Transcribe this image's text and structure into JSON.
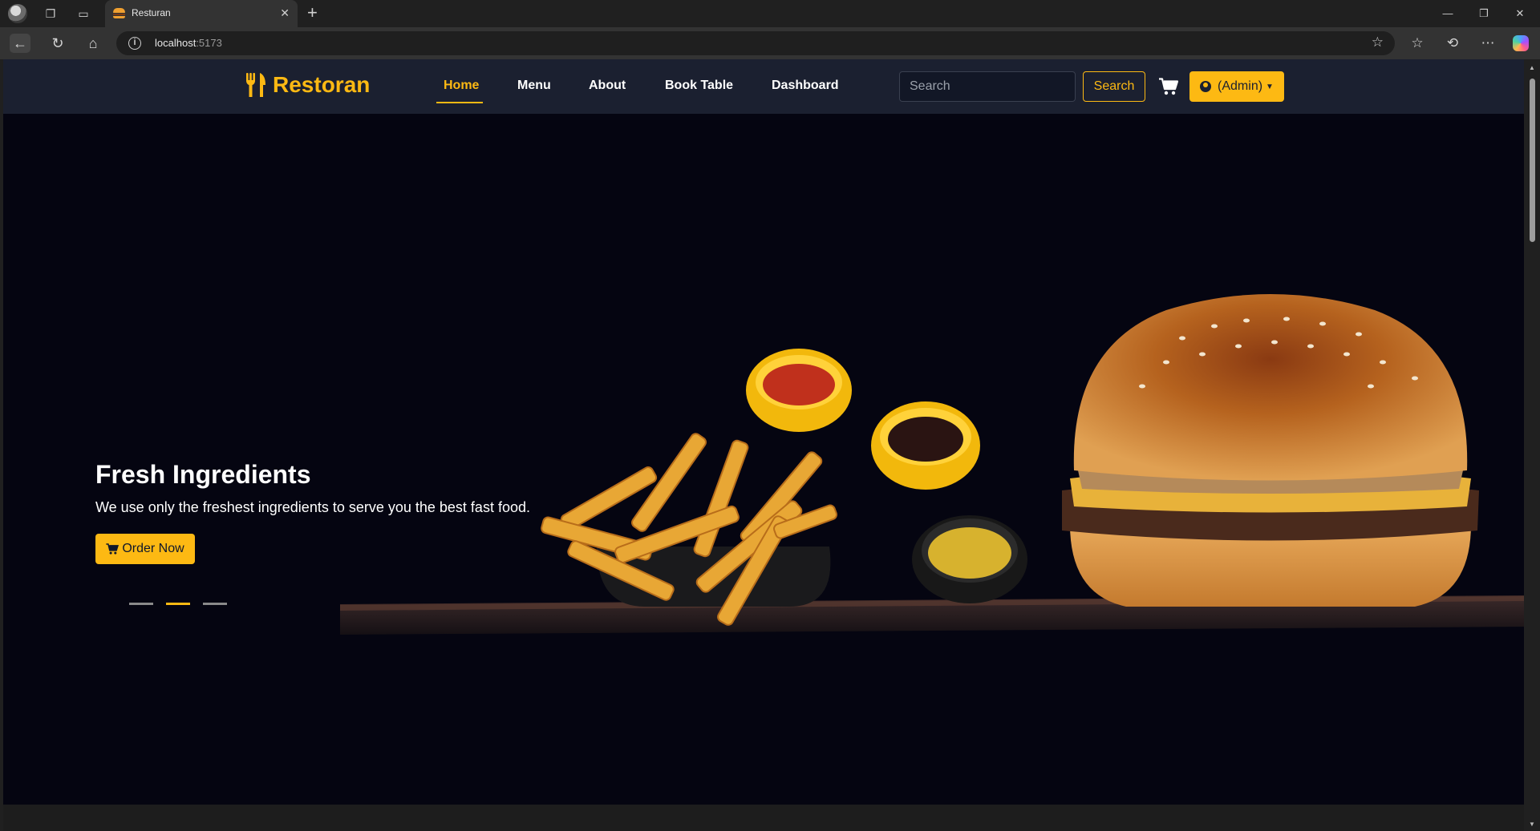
{
  "browser": {
    "tab_title": "Resturan",
    "url_host": "localhost",
    "url_port": ":5173",
    "icons": [
      "profile-avatar",
      "workspaces-icon",
      "tab-actions-icon",
      "back-icon",
      "refresh-icon",
      "home-icon",
      "info-icon",
      "favorite-star-icon",
      "favorites-icon",
      "history-icon",
      "more-icon",
      "copilot-icon"
    ]
  },
  "navbar": {
    "brand": "Restoran",
    "links": [
      "Home",
      "Menu",
      "About",
      "Book Table",
      "Dashboard"
    ],
    "active_link": "Home",
    "search_placeholder": "Search",
    "search_button": "Search",
    "account_label": "(Admin)"
  },
  "hero": {
    "title": "Fresh Ingredients",
    "subtitle": "We use only the freshest ingredients to serve you the best fast food.",
    "cta": "Order Now",
    "slides_count": 3,
    "active_slide": 2
  },
  "colors": {
    "accent": "#fdb913",
    "navbar_bg": "#1b2030",
    "hero_bg": "#050511"
  }
}
